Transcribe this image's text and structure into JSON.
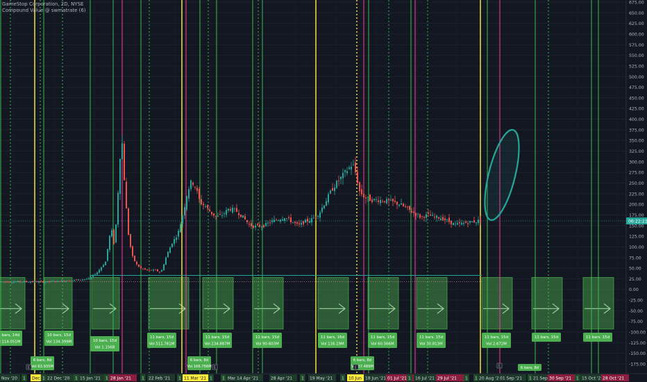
{
  "header": {
    "symbol_line": "GameStop Corporation, 2D, NYSE",
    "indicator_line": "Compound Value @ swmatrate (6)"
  },
  "chart_data": {
    "type": "candlestick",
    "title": "GameStop Corporation, 2D, NYSE",
    "ylim": [
      -200,
      680
    ],
    "y_ticks": [
      "675.00",
      "650.00",
      "625.00",
      "600.00",
      "575.00",
      "550.00",
      "525.00",
      "500.00",
      "475.00",
      "450.00",
      "425.00",
      "400.00",
      "375.00",
      "350.00",
      "325.00",
      "300.00",
      "275.00",
      "250.00",
      "225.00",
      "200.00",
      "175.00",
      "150.00",
      "125.00",
      "100.00",
      "75.00",
      "50.00",
      "25.00",
      "0.00",
      "-25.00",
      "-50.00",
      "-75.00",
      "-100.00",
      "-125.00",
      "-150.00",
      "-175.00"
    ],
    "current_time_label": "06:22:21",
    "current_level": 161,
    "x_labels": [
      {
        "text": "Nov '20",
        "style": "plain"
      },
      {
        "text": "1",
        "style": "plain"
      },
      {
        "text": "Dec",
        "style": "yellow"
      },
      {
        "text": "1",
        "style": "plain"
      },
      {
        "text": "22 Dec '20",
        "style": "plain"
      },
      {
        "text": "1",
        "style": "plain"
      },
      {
        "text": "15 Jan '21",
        "style": "plain"
      },
      {
        "text": "1",
        "style": "plain"
      },
      {
        "text": "28 Jan '21",
        "style": "red"
      },
      {
        "text": "1",
        "style": "plain"
      },
      {
        "text": "22 Feb '21",
        "style": "plain"
      },
      {
        "text": "1",
        "style": "plain"
      },
      {
        "text": "11 Mar '21",
        "style": "yellow"
      },
      {
        "text": "1",
        "style": "plain"
      },
      {
        "text": "1",
        "style": "plain"
      },
      {
        "text": "Mar '21",
        "style": "plain"
      },
      {
        "text": "14 Apr '21",
        "style": "plain"
      },
      {
        "text": "1",
        "style": "plain"
      },
      {
        "text": "28 Apr '21",
        "style": "plain"
      },
      {
        "text": "1",
        "style": "plain"
      },
      {
        "text": "19 May '21",
        "style": "plain"
      },
      {
        "text": "1",
        "style": "plain"
      },
      {
        "text": "10 Jun",
        "style": "yellow"
      },
      {
        "text": "18 Jun '21",
        "style": "plain"
      },
      {
        "text": "01 Jul '21",
        "style": "red"
      },
      {
        "text": "1",
        "style": "plain"
      },
      {
        "text": "16 Jul '21",
        "style": "plain"
      },
      {
        "text": "29 Jul '21",
        "style": "red"
      },
      {
        "text": "1",
        "style": "plain"
      },
      {
        "text": "1",
        "style": "plain"
      },
      {
        "text": "20 Aug '21",
        "style": "plain"
      },
      {
        "text": "01 Sep '21",
        "style": "plain"
      },
      {
        "text": "1",
        "style": "plain"
      },
      {
        "text": "21 Sep",
        "style": "plain"
      },
      {
        "text": "30 Sep '21",
        "style": "red"
      },
      {
        "text": "1",
        "style": "plain"
      },
      {
        "text": "15 Oct '21",
        "style": "plain"
      },
      {
        "text": "28 Oct '21",
        "style": "red"
      }
    ],
    "vlines": [
      {
        "color": "#39c049",
        "dash": false
      },
      {
        "color": "#39c049",
        "dash": true
      },
      {
        "color": "#ffeb3b",
        "dash": false
      },
      {
        "color": "#39c049",
        "dash": true
      },
      {
        "color": "#39c049",
        "dash": false
      },
      {
        "color": "#39c049",
        "dash": true
      },
      {
        "color": "#39c049",
        "dash": false
      },
      {
        "color": "#39c049",
        "dash": false
      },
      {
        "color": "#ff3ca0",
        "dash": false
      },
      {
        "color": "#39c049",
        "dash": false
      },
      {
        "color": "#39c049",
        "dash": true
      },
      {
        "color": "#ffeb3b",
        "dash": false
      },
      {
        "color": "#ff3ca0",
        "dash": false
      },
      {
        "color": "#39c049",
        "dash": false
      },
      {
        "color": "#39c049",
        "dash": true
      },
      {
        "color": "#39c049",
        "dash": false
      },
      {
        "color": "#39c049",
        "dash": false
      },
      {
        "color": "#39c049",
        "dash": true
      },
      {
        "color": "#39c049",
        "dash": false
      },
      {
        "color": "#ffeb3b",
        "dash": false
      },
      {
        "color": "#ffeb3b",
        "dash": true
      },
      {
        "color": "#ff3ca0",
        "dash": false
      },
      {
        "color": "#39c049",
        "dash": false
      },
      {
        "color": "#39c049",
        "dash": true
      },
      {
        "color": "#39c049",
        "dash": false
      },
      {
        "color": "#ff3ca0",
        "dash": false
      },
      {
        "color": "#39c049",
        "dash": true
      },
      {
        "color": "#ffeb3b",
        "dash": false
      },
      {
        "color": "#39c049",
        "dash": false
      },
      {
        "color": "#ff3ca0",
        "dash": false
      },
      {
        "color": "#39c049",
        "dash": false
      },
      {
        "color": "#39c049",
        "dash": true
      },
      {
        "color": "#39c049",
        "dash": false
      },
      {
        "color": "#39c049",
        "dash": false
      }
    ],
    "boxes": [
      {
        "label": "11 bars, 14d",
        "vol": "Vol 114.051M"
      },
      {
        "label": "10 bars, 15d",
        "vol": "Vol 134.399M"
      },
      {
        "label": "10 bars, 15d",
        "vol": "Vol 1.156B"
      },
      {
        "label": "11 bars, 15d",
        "vol": "Vol 511.761M"
      },
      {
        "label": "11 bars, 15d",
        "vol": "Vol 234.887M"
      },
      {
        "label": "11 bars, 15d",
        "vol": "Vol 90.603M"
      },
      {
        "label": "11 bars, 16d",
        "vol": "Vol 116.19M"
      },
      {
        "label": "11 bars, 15d",
        "vol": "Vol 60.566M"
      },
      {
        "label": "11 bars, 15d",
        "vol": "Vol 30.813M"
      },
      {
        "label": "11 bars, 15d",
        "vol": "Vol 2.672M"
      },
      {
        "label": "11 bars, 15d",
        "vol": ""
      },
      {
        "label": "11 bars, 15d",
        "vol": ""
      }
    ],
    "small_labels": [
      {
        "label": "6 bars, 8d",
        "vol": "Vol 63.935M"
      },
      {
        "label": "6 bars, 8d",
        "vol": "Vol 166.766M"
      },
      {
        "label": "6 bars, 8d",
        "vol": "Vol 67.489M"
      },
      {
        "label": "6 bars, 8d",
        "vol": ""
      }
    ],
    "event_markers": [
      "E",
      "E",
      "E",
      "E"
    ],
    "price_path": [
      [
        0,
        18
      ],
      [
        44,
        18
      ],
      [
        66,
        18
      ],
      [
        90,
        20
      ],
      [
        110,
        22
      ],
      [
        128,
        25
      ],
      [
        140,
        40
      ],
      [
        152,
        65
      ],
      [
        160,
        145
      ],
      [
        165,
        100
      ],
      [
        170,
        230
      ],
      [
        175,
        370
      ],
      [
        179,
        260
      ],
      [
        184,
        140
      ],
      [
        190,
        80
      ],
      [
        196,
        60
      ],
      [
        202,
        50
      ],
      [
        212,
        45
      ],
      [
        224,
        45
      ],
      [
        232,
        40
      ],
      [
        240,
        80
      ],
      [
        248,
        110
      ],
      [
        256,
        130
      ],
      [
        264,
        180
      ],
      [
        270,
        230
      ],
      [
        276,
        255
      ],
      [
        282,
        240
      ],
      [
        288,
        205
      ],
      [
        296,
        195
      ],
      [
        304,
        180
      ],
      [
        312,
        170
      ],
      [
        320,
        175
      ],
      [
        330,
        190
      ],
      [
        340,
        185
      ],
      [
        350,
        170
      ],
      [
        360,
        150
      ],
      [
        370,
        148
      ],
      [
        380,
        150
      ],
      [
        392,
        160
      ],
      [
        402,
        165
      ],
      [
        410,
        170
      ],
      [
        420,
        160
      ],
      [
        430,
        150
      ],
      [
        440,
        160
      ],
      [
        450,
        165
      ],
      [
        460,
        180
      ],
      [
        470,
        210
      ],
      [
        480,
        240
      ],
      [
        490,
        260
      ],
      [
        500,
        280
      ],
      [
        508,
        295
      ],
      [
        513,
        270
      ],
      [
        518,
        230
      ],
      [
        526,
        215
      ],
      [
        536,
        210
      ],
      [
        546,
        210
      ],
      [
        556,
        208
      ],
      [
        566,
        205
      ],
      [
        576,
        200
      ],
      [
        586,
        190
      ],
      [
        596,
        180
      ],
      [
        606,
        170
      ],
      [
        616,
        175
      ],
      [
        626,
        170
      ],
      [
        636,
        168
      ],
      [
        646,
        160
      ],
      [
        656,
        152
      ],
      [
        666,
        155
      ],
      [
        676,
        158
      ],
      [
        686,
        160
      ],
      [
        694,
        164
      ]
    ]
  }
}
